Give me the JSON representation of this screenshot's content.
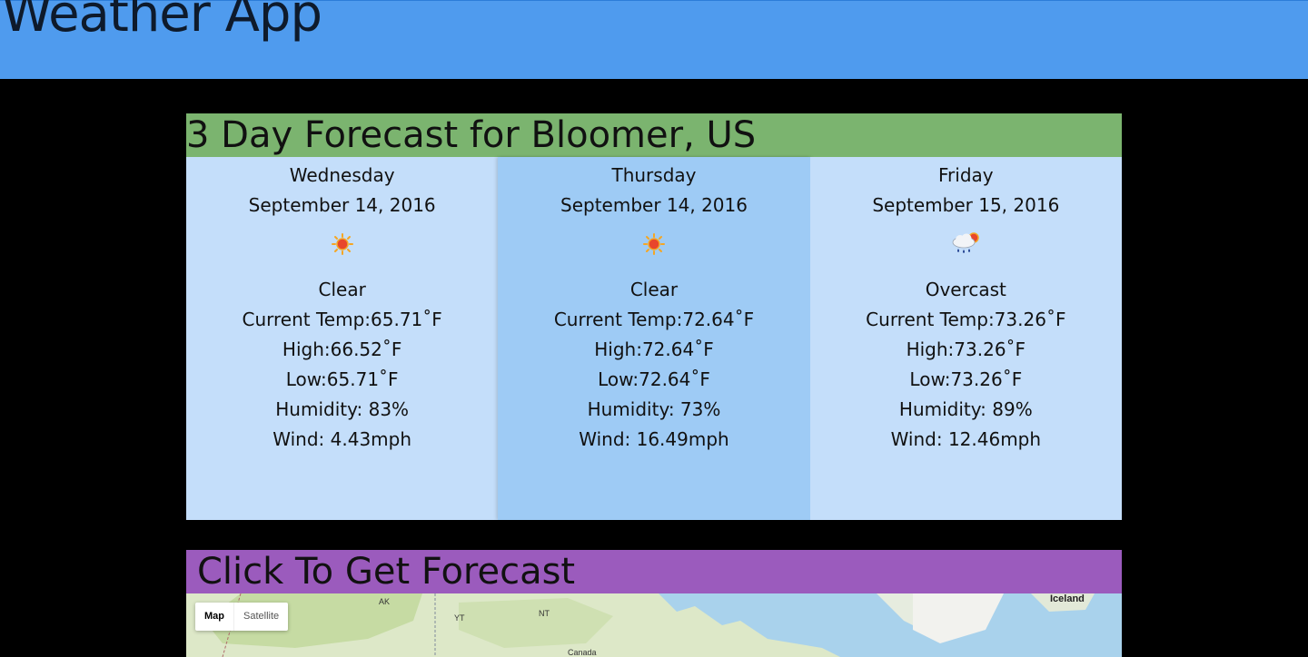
{
  "header": {
    "title": "Weather App"
  },
  "forecast": {
    "title": "3 Day Forecast for Bloomer, US",
    "days": [
      {
        "day": "Wednesday",
        "date": "September 14, 2016",
        "icon": "sun-icon",
        "condition": "Clear",
        "current_temp": "Current Temp:65.71˚F",
        "high": "High:66.52˚F",
        "low": "Low:65.71˚F",
        "humidity": "Humidity: 83%",
        "wind": "Wind: 4.43mph"
      },
      {
        "day": "Thursday",
        "date": "September 14, 2016",
        "icon": "sun-icon",
        "condition": "Clear",
        "current_temp": "Current Temp:72.64˚F",
        "high": "High:72.64˚F",
        "low": "Low:72.64˚F",
        "humidity": "Humidity: 73%",
        "wind": "Wind: 16.49mph"
      },
      {
        "day": "Friday",
        "date": "September 15, 2016",
        "icon": "rain-cloud-icon",
        "condition": "Overcast",
        "current_temp": "Current Temp:73.26˚F",
        "high": "High:73.26˚F",
        "low": "Low:73.26˚F",
        "humidity": "Humidity: 89%",
        "wind": "Wind: 12.46mph"
      }
    ]
  },
  "map": {
    "title": "Click To Get Forecast",
    "type_controls": {
      "map": "Map",
      "satellite": "Satellite"
    },
    "labels": {
      "ak": "AK",
      "yt": "YT",
      "nt": "NT",
      "canada": "Canada",
      "iceland": "Iceland"
    }
  },
  "colors": {
    "header_bg": "#4f9bee",
    "forecast_title_bg": "#7bb46f",
    "day_bg": "#c4defa",
    "day_middle_bg": "#9ecbf5",
    "map_title_bg": "#9b5bbd"
  }
}
